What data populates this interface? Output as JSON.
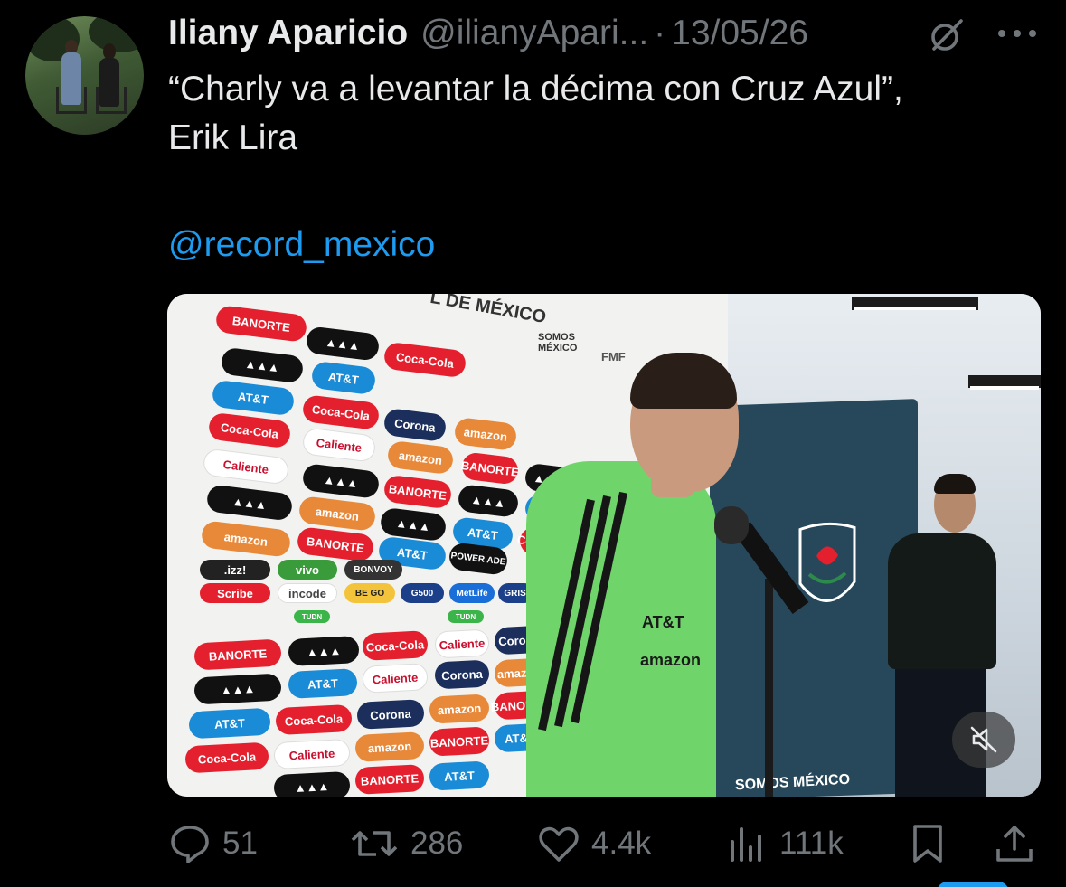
{
  "tweet": {
    "author_name": "Iliany Aparicio",
    "author_handle": "@ilianyApari...",
    "separator": "·",
    "date": "13/05/26",
    "text": "“Charly va a levantar la décima con Cruz Azul”,\nErik Lira",
    "mention": "@record_mexico"
  },
  "media": {
    "wall_text": "L DE MÉXICO",
    "sponsors": {
      "banorte": "BANORTE",
      "att": "AT&T",
      "cocacola": "Coca-Cola",
      "amazon": "amazon",
      "corona": "Corona",
      "caliente": "Caliente",
      "powerade": "POWER ADE",
      "scribe": "Scribe",
      "incode": "incode",
      "vivo": "vivo",
      "izzi": ".izz!",
      "bonvoy": "BONVOY",
      "beyo": "BE GO",
      "g500": "G500",
      "metlife": "MetLife",
      "grisi": "GRISI",
      "fmf": "FMF",
      "somos": "SOMOS MÉXICO",
      "somos_bottom": "SOMOS MÉXICO",
      "tudn": "TUDN"
    },
    "jersey": {
      "att": "AT&T",
      "amazon": "amazon"
    },
    "mute_icon": "speaker-muted-icon"
  },
  "actions": {
    "replies": "51",
    "reposts": "286",
    "likes": "4.4k",
    "views": "111k"
  },
  "colors": {
    "background": "#000000",
    "text": "#e7e9ea",
    "muted": "#71767b",
    "link": "#1d9bf0"
  },
  "icons": [
    "grok-icon",
    "more-icon",
    "reply-icon",
    "repost-icon",
    "like-icon",
    "views-icon",
    "bookmark-icon",
    "share-icon"
  ]
}
